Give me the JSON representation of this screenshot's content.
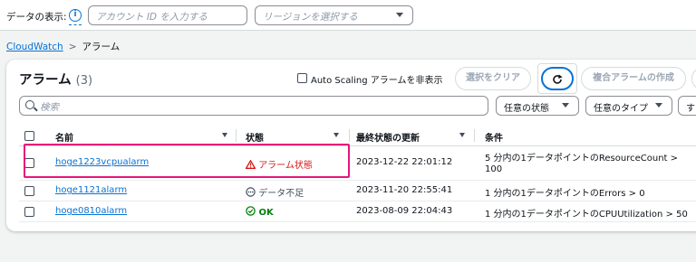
{
  "topbar": {
    "display_label": "データの表示:",
    "account_placeholder": "アカウント ID を入力する",
    "region_placeholder": "リージョンを選択する"
  },
  "breadcrumb": {
    "root": "CloudWatch",
    "current": "アラーム"
  },
  "panel": {
    "title": "アラーム",
    "count": "(3)",
    "autoscaling_label": "Auto Scaling アラームを非表示",
    "clear_selection": "選択をクリア",
    "create_composite": "複合アラームの作成",
    "search_placeholder": "検索",
    "filter_state": "任意の状態",
    "filter_type": "任意のタイプ",
    "filter_extra": "す"
  },
  "table": {
    "headers": {
      "name": "名前",
      "state": "状態",
      "last_updated": "最終状態の更新",
      "conditions": "条件"
    },
    "rows": [
      {
        "name": "hoge1223vcpualarm",
        "state": "アラーム状態",
        "updated": "2023-12-22 22:01:12",
        "cond1": "5 分内の1データポイントのResourceCount >",
        "cond2": "100"
      },
      {
        "name": "hoge1121alarm",
        "state": "データ不足",
        "updated": "2023-11-20 22:55:41",
        "cond1": "1 分内の1データポイントのErrors > 0"
      },
      {
        "name": "hoge0810alarm",
        "state": "OK",
        "updated": "2023-08-09 22:04:43",
        "cond1": "1 分内の1データポイントのCPUUtilization > 50"
      }
    ]
  },
  "colors": {
    "alarm": "#d91515",
    "ok": "#037f0c",
    "link": "#0972d3",
    "highlight": "#e7157b"
  }
}
